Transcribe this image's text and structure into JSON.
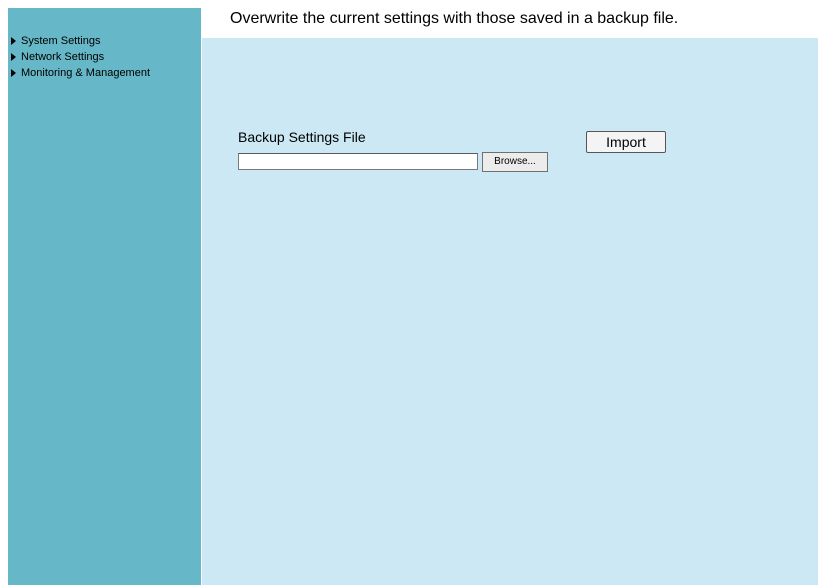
{
  "sidebar": {
    "items": [
      {
        "label": "System Settings",
        "icon": "triangle-right-icon"
      },
      {
        "label": "Network Settings",
        "icon": "triangle-right-icon"
      },
      {
        "label": "Monitoring & Management",
        "icon": "triangle-right-icon"
      }
    ]
  },
  "main": {
    "title": "Overwrite the current settings with those saved in a backup file.",
    "backup_label": "Backup Settings File",
    "file_input": {
      "value": "",
      "placeholder": ""
    },
    "browse_label": "Browse...",
    "import_label": "Import"
  },
  "colors": {
    "sidebar_bg": "#66b7c7",
    "main_bg": "#cde8f5",
    "header_bg": "#ffffff"
  }
}
